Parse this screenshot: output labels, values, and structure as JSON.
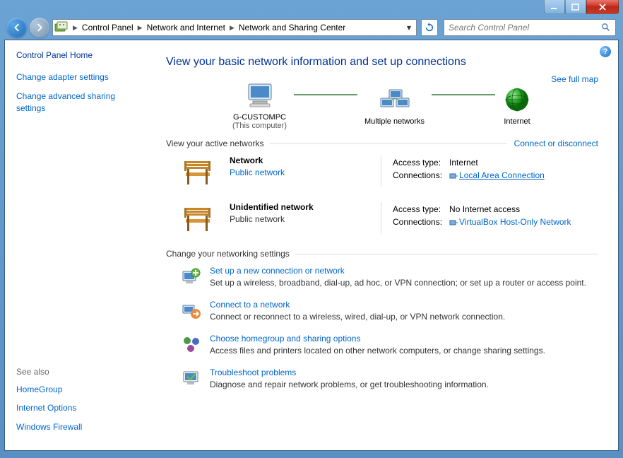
{
  "breadcrumb": {
    "root": "Control Panel",
    "mid": "Network and Internet",
    "leaf": "Network and Sharing Center"
  },
  "search": {
    "placeholder": "Search Control Panel"
  },
  "sidebar": {
    "home": "Control Panel Home",
    "links": [
      "Change adapter settings",
      "Change advanced sharing settings"
    ],
    "see_also_hdr": "See also",
    "see_also": [
      "HomeGroup",
      "Internet Options",
      "Windows Firewall"
    ]
  },
  "main": {
    "title": "View your basic network information and set up connections",
    "see_map": "See full map",
    "map": {
      "computer": "G-CUSTOMPC",
      "computer_sub": "(This computer)",
      "middle": "Multiple networks",
      "internet": "Internet"
    },
    "active_hdr": "View your active networks",
    "active_link": "Connect or disconnect",
    "networks": [
      {
        "name": "Network",
        "type": "Public network",
        "type_link": true,
        "access_lbl": "Access type:",
        "access": "Internet",
        "conn_lbl": "Connections:",
        "conn": "Local Area Connection",
        "conn_underline": true
      },
      {
        "name": "Unidentified network",
        "type": "Public network",
        "type_link": false,
        "access_lbl": "Access type:",
        "access": "No Internet access",
        "conn_lbl": "Connections:",
        "conn": "VirtualBox Host-Only Network",
        "conn_underline": false
      }
    ],
    "settings_hdr": "Change your networking settings",
    "settings": [
      {
        "title": "Set up a new connection or network",
        "desc": "Set up a wireless, broadband, dial-up, ad hoc, or VPN connection; or set up a router or access point."
      },
      {
        "title": "Connect to a network",
        "desc": "Connect or reconnect to a wireless, wired, dial-up, or VPN network connection."
      },
      {
        "title": "Choose homegroup and sharing options",
        "desc": "Access files and printers located on other network computers, or change sharing settings."
      },
      {
        "title": "Troubleshoot problems",
        "desc": "Diagnose and repair network problems, or get troubleshooting information."
      }
    ]
  }
}
